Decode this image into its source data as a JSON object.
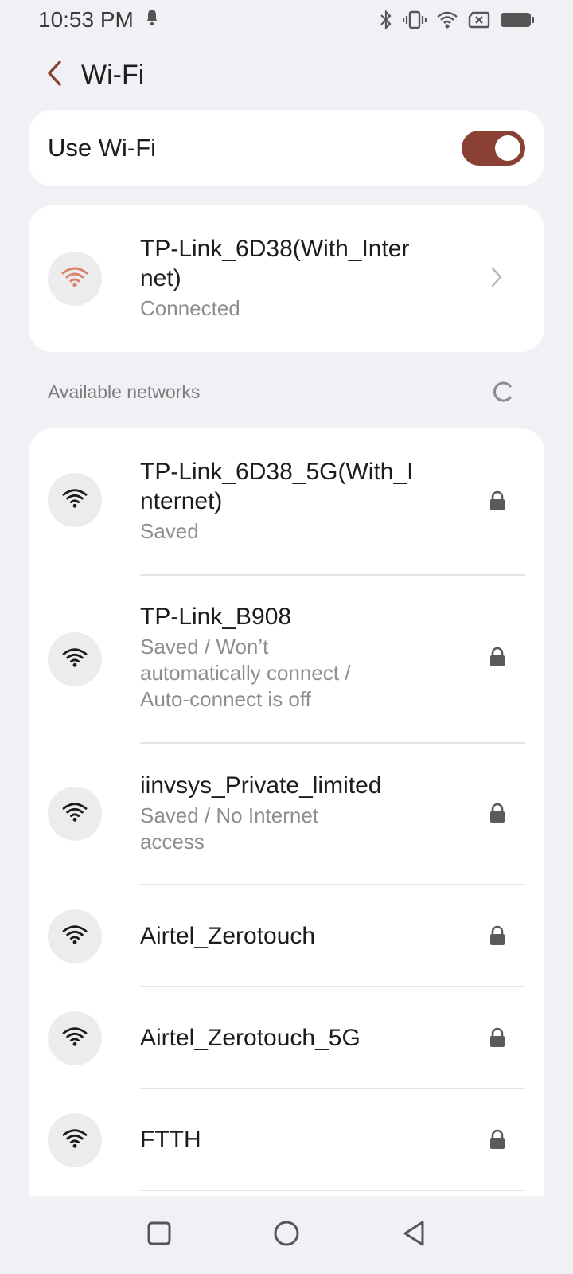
{
  "status_bar": {
    "time": "10:53 PM",
    "icons": [
      "notification-bell-icon",
      "bluetooth-icon",
      "vibrate-icon",
      "wifi-icon",
      "no-sim-icon",
      "battery-icon"
    ]
  },
  "header": {
    "title": "Wi-Fi",
    "back_icon": "chevron-left-icon"
  },
  "wifi_toggle": {
    "label": "Use Wi-Fi",
    "enabled": true
  },
  "connected_network": {
    "name": "TP-Link_6D38(With_Internet)",
    "status": "Connected",
    "icon": "wifi-icon"
  },
  "available": {
    "header": "Available networks",
    "refresh_icon": "refresh-icon",
    "networks": [
      {
        "name": "TP-Link_6D38_5G(With_Internet)",
        "status": "Saved",
        "secured": true
      },
      {
        "name": "TP-Link_B908",
        "status": "Saved / Won’t automatically connect / Auto-connect is off",
        "secured": true
      },
      {
        "name": "iinvsys_Private_limited",
        "status": "Saved / No Internet access",
        "secured": true
      },
      {
        "name": "Airtel_Zerotouch",
        "status": "",
        "secured": true
      },
      {
        "name": "Airtel_Zerotouch_5G",
        "status": "",
        "secured": true
      },
      {
        "name": "FTTH",
        "status": "",
        "secured": true
      }
    ]
  },
  "nav_bar": {
    "buttons": [
      "recents-square-icon",
      "home-circle-icon",
      "back-triangle-icon"
    ]
  },
  "colors": {
    "accent": "#8a4033",
    "connected_wifi": "#d9826c",
    "background": "#f0f1f4",
    "card": "#ffffff"
  }
}
